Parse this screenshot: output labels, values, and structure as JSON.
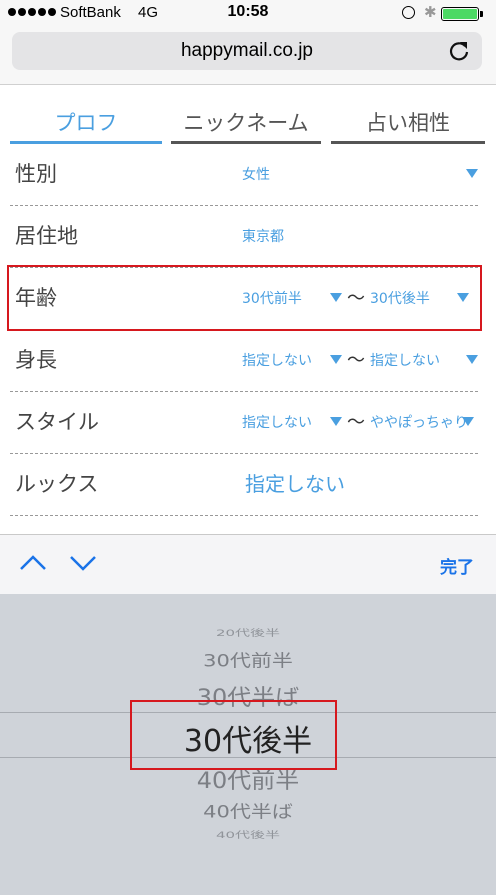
{
  "status_bar": {
    "carrier": "SoftBank",
    "network": "4G",
    "time": "10:58",
    "battery_color": "#4cd964"
  },
  "browser": {
    "url": "happymail.co.jp",
    "reload_icon": "reload-icon"
  },
  "tabs": [
    {
      "label": "プロフ",
      "active": true
    },
    {
      "label": "ニックネーム",
      "active": false
    },
    {
      "label": "占い相性",
      "active": false
    }
  ],
  "rows": {
    "gender": {
      "label": "性別",
      "value": "女性"
    },
    "residence": {
      "label": "居住地",
      "value": "東京都"
    },
    "age": {
      "label": "年齢",
      "from": "30代前半",
      "separator": "〜",
      "to": "30代後半"
    },
    "height": {
      "label": "身長",
      "from": "指定しない",
      "separator": "〜",
      "to": "指定しない"
    },
    "style": {
      "label": "スタイル",
      "from": "指定しない",
      "separator": "〜",
      "to": "ややぽっちゃり"
    },
    "looks": {
      "label": "ルックス",
      "value": "指定しない"
    }
  },
  "accessory": {
    "prev_icon": "chevron-up-icon",
    "next_icon": "chevron-down-icon",
    "done_label": "完了"
  },
  "picker": {
    "options": [
      "20代後半",
      "30代前半",
      "30代半ば",
      "30代後半",
      "40代前半",
      "40代半ば",
      "40代後半"
    ],
    "selected": "30代後半"
  },
  "colors": {
    "accent": "#4a9fe0",
    "highlight": "#d6181e",
    "done": "#1a73e8"
  }
}
